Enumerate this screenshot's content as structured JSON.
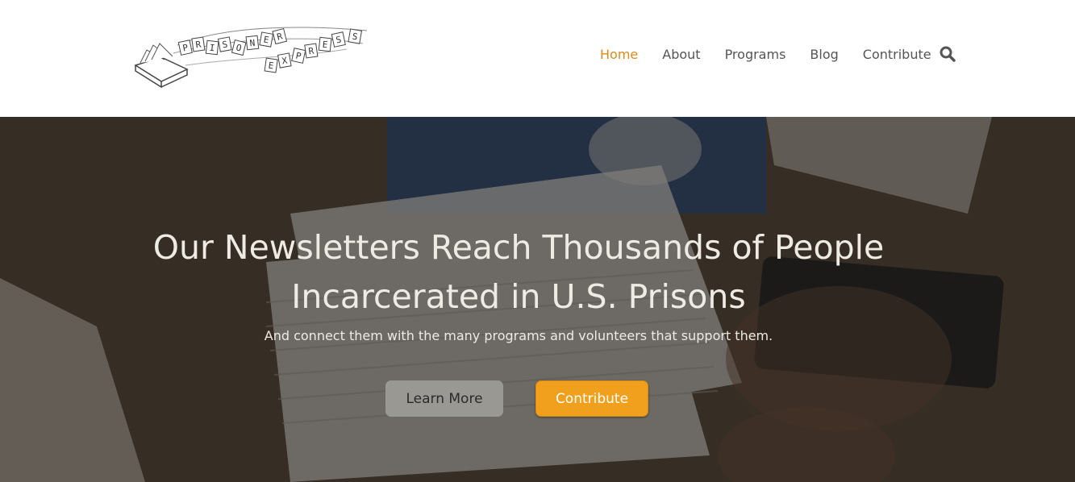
{
  "logo": {
    "alt": "Prisoner Express",
    "letters": [
      "P",
      "R",
      "I",
      "S",
      "O",
      "N",
      "E",
      "R",
      "E",
      "X",
      "P",
      "R",
      "E",
      "S",
      "S"
    ]
  },
  "nav": {
    "items": [
      {
        "label": "Home",
        "active": true
      },
      {
        "label": "About",
        "active": false
      },
      {
        "label": "Programs",
        "active": false
      },
      {
        "label": "Blog",
        "active": false
      },
      {
        "label": "Contribute",
        "active": false
      }
    ],
    "search_icon": "search-icon"
  },
  "hero": {
    "title_line1": "Our Newsletters Reach Thousands of People",
    "title_line2": "Incarcerated in U.S. Prisons",
    "subtitle": "And connect them with the many programs and volunteers that support them.",
    "learn_more_label": "Learn More",
    "contribute_label": "Contribute"
  },
  "colors": {
    "accent": "#f0a01c",
    "nav_active": "#d98a1f",
    "nav_text": "#555555"
  }
}
